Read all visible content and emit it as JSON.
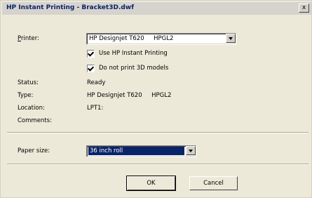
{
  "window": {
    "title": "HP Instant Printing - Bracket3D.dwf",
    "close_glyph": "x"
  },
  "printer": {
    "label": "Printer:",
    "value": "HP Designjet T620     HPGL2",
    "options": {
      "use_instant": {
        "label": "Use HP Instant Printing",
        "checked": true
      },
      "no_3d": {
        "label": "Do not print 3D models",
        "checked": true
      }
    }
  },
  "info": {
    "status_label": "Status:",
    "status_value": "Ready",
    "type_label": "Type:",
    "type_value": "HP Designjet T620     HPGL2",
    "location_label": "Location:",
    "location_value": "LPT1:",
    "comments_label": "Comments:",
    "comments_value": ""
  },
  "paper": {
    "label": "Paper size:",
    "value": "36 inch roll"
  },
  "buttons": {
    "ok": "OK",
    "cancel": "Cancel"
  }
}
